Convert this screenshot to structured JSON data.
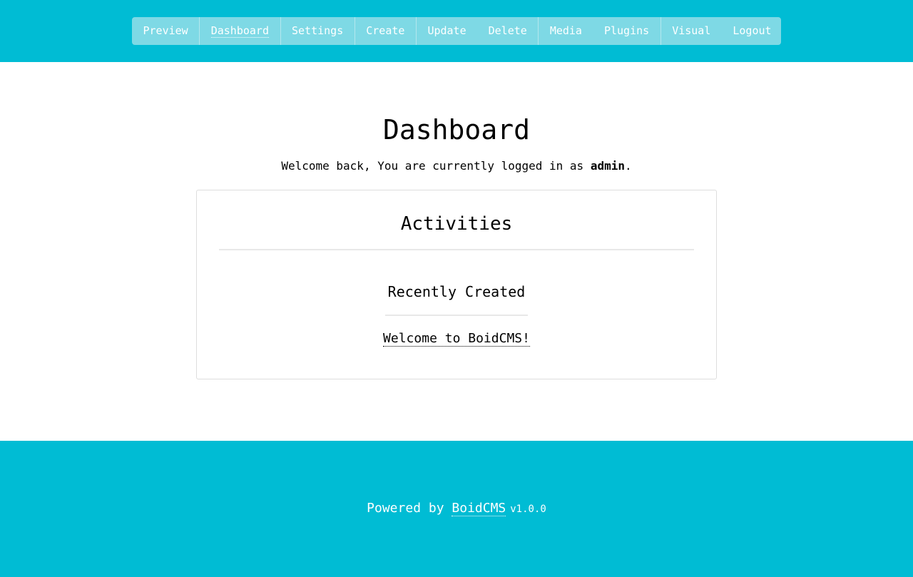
{
  "nav": {
    "items": [
      {
        "label": "Preview"
      },
      {
        "label": "Dashboard",
        "active": true
      },
      {
        "label": "Settings"
      },
      {
        "label": "Create"
      },
      {
        "label": "Update"
      },
      {
        "label": "Delete"
      },
      {
        "label": "Media"
      },
      {
        "label": "Plugins"
      },
      {
        "label": "Visual"
      },
      {
        "label": "Logout"
      }
    ]
  },
  "page": {
    "title": "Dashboard",
    "welcome_prefix": "Welcome back, You are currently logged in as ",
    "username": "admin",
    "welcome_suffix": "."
  },
  "activities": {
    "title": "Activities",
    "recent_title": "Recently Created",
    "recent_items": [
      "Welcome to BoidCMS!"
    ]
  },
  "footer": {
    "powered_by": "Powered by ",
    "brand": "BoidCMS",
    "version": "v1.0.0"
  },
  "colors": {
    "brand": "#00bcd4",
    "nav_bg": "#7ed9e5"
  }
}
